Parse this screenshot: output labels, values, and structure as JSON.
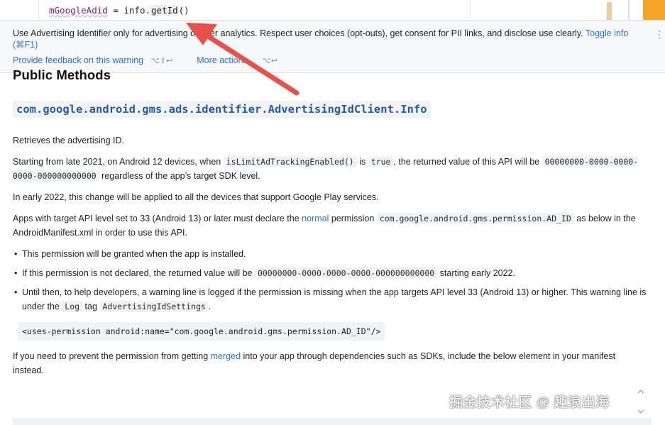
{
  "editor": {
    "code_var": "mGoogleAdid",
    "code_mid": " = info.",
    "code_method": "getId",
    "code_end": "()"
  },
  "warning": {
    "text": "Use Advertising Identifier only for advertising or user analytics. Respect user choices (opt-outs), get consent for PII links, and disclose use clearly.",
    "toggle_info": "Toggle info (⌘F1)",
    "feedback_link": "Provide feedback on this warning",
    "feedback_shortcut": "⌥⇧↩",
    "more_actions": "More actions...",
    "more_shortcut": "⌥↩",
    "kebab_icon": "more-vertical-icon"
  },
  "doc": {
    "title": "Public Methods",
    "class_name": "com.google.android.gms.ads.identifier.AdvertisingIdClient.Info",
    "p1": "Retrieves the advertising ID.",
    "p2_a": "Starting from late 2021, on Android 12 devices, when ",
    "p2_code1": "isLimitAdTrackingEnabled()",
    "p2_b": " is ",
    "p2_code2": "true",
    "p2_c": ", the returned value of this API will be ",
    "p2_code3": "00000000-0000-0000-0000-000000000000",
    "p2_d": " regardless of the app’s target SDK level.",
    "p3": "In early 2022, this change will be applied to all the devices that support Google Play services.",
    "p4_a": "Apps with target API level set to 33 (Android 13) or later must declare the ",
    "p4_link": "normal",
    "p4_b": " permission ",
    "p4_code": "com.google.android.gms.permission.AD_ID",
    "p4_c": " as below in the AndroidManifest.xml in order to use this API.",
    "bullet1": "This permission will be granted when the app is installed.",
    "bullet2_a": "If this permission is not declared, the returned value will be ",
    "bullet2_code": "00000000-0000-0000-0000-000000000000",
    "bullet2_b": " starting early 2022.",
    "bullet3_a": "Until then, to help developers, a warning line is logged if the permission is missing when the app targets API level 33 (Android 13) or higher. This warning line is under the ",
    "bullet3_code1": "Log",
    "bullet3_b": " tag ",
    "bullet3_code2": "AdvertisingIdSettings",
    "bullet3_c": ".",
    "codeblock": "<uses-permission android:name=\"com.google.android.gms.permission.AD_ID\"/>",
    "p5_a": "If you need to prevent the permission from getting ",
    "p5_link": "merged",
    "p5_b": " into your app through dependencies such as SDKs, include the below element in your manifest instead."
  },
  "watermark": "掘金技术社区 @ 趣浪出海",
  "colors": {
    "link": "#2f6fd6",
    "arrow": "#e8504a",
    "accent_tab": "#f5a42a",
    "class_name": "#2c5aa0"
  }
}
